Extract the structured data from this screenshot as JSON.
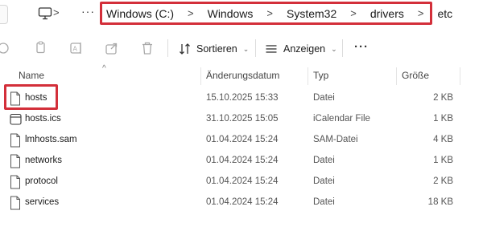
{
  "breadcrumb": {
    "more": "···",
    "items": [
      "Windows (C:)",
      "Windows",
      "System32",
      "drivers",
      "etc"
    ],
    "separator": ">"
  },
  "toolbar": {
    "sort_label": "Sortieren",
    "view_label": "Anzeigen",
    "more_label": "···",
    "chevron": "⌄"
  },
  "columns": {
    "name": "Name",
    "date": "Änderungsdatum",
    "type": "Typ",
    "size": "Größe"
  },
  "files": [
    {
      "name": "hosts",
      "date": "15.10.2025 15:33",
      "type": "Datei",
      "size": "2 KB",
      "icon": "file-icon"
    },
    {
      "name": "hosts.ics",
      "date": "31.10.2025 15:05",
      "type": "iCalendar File",
      "size": "1 KB",
      "icon": "calendar-icon"
    },
    {
      "name": "lmhosts.sam",
      "date": "01.04.2024 15:24",
      "type": "SAM-Datei",
      "size": "4 KB",
      "icon": "file-icon"
    },
    {
      "name": "networks",
      "date": "01.04.2024 15:24",
      "type": "Datei",
      "size": "1 KB",
      "icon": "file-icon"
    },
    {
      "name": "protocol",
      "date": "01.04.2024 15:24",
      "type": "Datei",
      "size": "2 KB",
      "icon": "file-icon"
    },
    {
      "name": "services",
      "date": "01.04.2024 15:24",
      "type": "Datei",
      "size": "18 KB",
      "icon": "file-icon"
    }
  ],
  "colors": {
    "highlight": "#d32f3a",
    "background": "#ffffff"
  }
}
